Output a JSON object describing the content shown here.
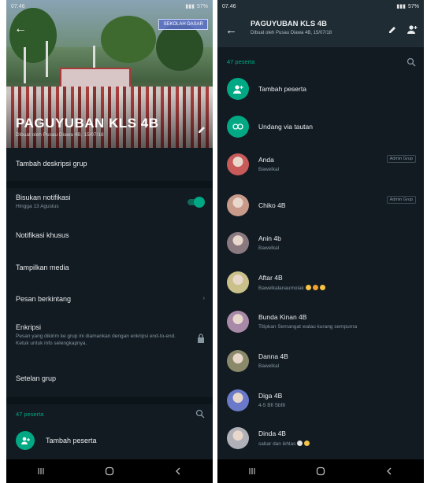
{
  "status_bar": {
    "time": "07.46",
    "battery": "57%"
  },
  "group_info": {
    "group_name": "PAGUYUBAN KLS 4B",
    "created_by": "Dibuat oleh Pusau Diawa 4B, 15/07/18",
    "banner_sign": "SEKOLAH DASAR",
    "add_description": "Tambah deskripsi grup",
    "mute": {
      "label": "Bisukan notifikasi",
      "sub": "Hingga 13 Agustus",
      "on": true
    },
    "custom_notifications": "Notifikasi khusus",
    "media_visibility": "Tampilkan media",
    "disappearing": "Pesan berkintang",
    "encryption": {
      "label": "Enkripsi",
      "sub": "Pesan yang dikirim ke grup ini diamankan dengan enkripsi end-to-end. Ketuk untuk info selengkapnya."
    },
    "group_settings": "Setelan grup",
    "participants_count": "47 peserta",
    "add_participant": "Tambah peserta"
  },
  "participant_list": {
    "title": "PAGUYUBAN KLS 4B",
    "subtitle": "Dibuat oleh Pusau Diawa 4B, 15/07/18",
    "count": "47 peserta",
    "actions": [
      {
        "label": "Tambah peserta"
      },
      {
        "label": "Undang via tautan"
      }
    ],
    "members": [
      {
        "name": "Anda",
        "status": "Bawelkal",
        "badge": "Admin Grup",
        "color": "#c85a5a"
      },
      {
        "name": "Chiko 4B",
        "status": "",
        "badge": "Admin Grup",
        "color": "#c79a8a"
      },
      {
        "name": "Anin 4b",
        "status": "Bawelkal",
        "badge": "",
        "color": "#8a7a80"
      },
      {
        "name": "Aftar 4B",
        "status": "Bawelkalanaumolak",
        "badge": "",
        "color": "#c9c08a"
      },
      {
        "name": "Bunda Kinan 4B",
        "status": "Titipkan Semangat walau kurang sempurna",
        "badge": "",
        "color": "#a88aa8"
      },
      {
        "name": "Danna 4B",
        "status": "Bawelkal",
        "badge": "",
        "color": "#8a8a6a"
      },
      {
        "name": "Diga 4B",
        "status": "4-5 Bfl Sbf8",
        "badge": "",
        "color": "#6a7ac8"
      },
      {
        "name": "Dinda 4B",
        "status": "sabar dan ikhlas",
        "badge": "",
        "color": "#b0b0b8"
      }
    ]
  },
  "colors": {
    "accent": "#00a884",
    "background": "#121b22",
    "appbar": "#1f2c34"
  }
}
